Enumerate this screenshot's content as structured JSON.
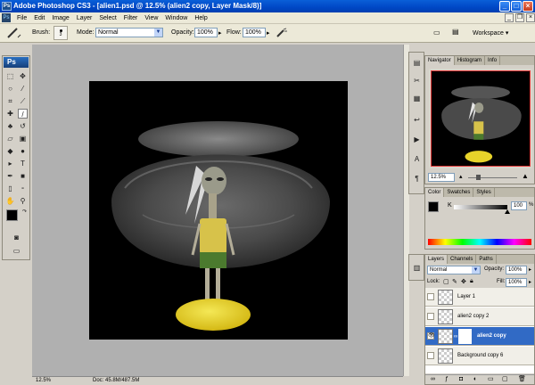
{
  "window": {
    "title": "Adobe Photoshop CS3 - [alien1.psd @ 12.5% (alien2 copy, Layer Mask/8)]",
    "controls": [
      "_",
      "□",
      "×"
    ]
  },
  "menu": {
    "ps_badge": "Ps",
    "items": [
      "File",
      "Edit",
      "Image",
      "Layer",
      "Select",
      "Filter",
      "View",
      "Window",
      "Help"
    ],
    "doc_controls": [
      "_",
      "❐",
      "×"
    ]
  },
  "options": {
    "brush_label": "Brush:",
    "brush_size": "3",
    "mode_label": "Mode:",
    "mode_value": "Normal",
    "opacity_label": "Opacity:",
    "opacity_value": "100%",
    "flow_label": "Flow:",
    "flow_value": "100%",
    "workspace_label": "Workspace ▾"
  },
  "toolbox": {
    "logo": "Ps"
  },
  "status": {
    "zoom": "12.5%",
    "doc": "Doc: 45.8M/487.5M"
  },
  "navigator": {
    "tabs": [
      "Navigator",
      "Histogram",
      "Info"
    ],
    "zoom": "12.5%"
  },
  "color": {
    "tabs": [
      "Color",
      "Swatches",
      "Styles"
    ],
    "k_label": "K",
    "k_value": "100",
    "k_fraction": 1.0
  },
  "layers": {
    "tabs": [
      "Layers",
      "Channels",
      "Paths"
    ],
    "blend_mode": "Normal",
    "opacity_label": "Opacity:",
    "opacity_value": "100%",
    "lock_label": "Lock:",
    "fill_label": "Fill:",
    "fill_value": "100%",
    "items": [
      {
        "name": "Layer 1",
        "selected": false,
        "visible": false
      },
      {
        "name": "alien2 copy 2",
        "selected": false,
        "visible": false
      },
      {
        "name": "alien2 copy",
        "selected": true,
        "visible": true
      },
      {
        "name": "Background copy 6",
        "selected": false,
        "visible": false
      }
    ]
  },
  "colors": {
    "title_bar": "#0a5fd8",
    "selection": "#316ac5",
    "shell_yellow": "#e7d32a"
  }
}
